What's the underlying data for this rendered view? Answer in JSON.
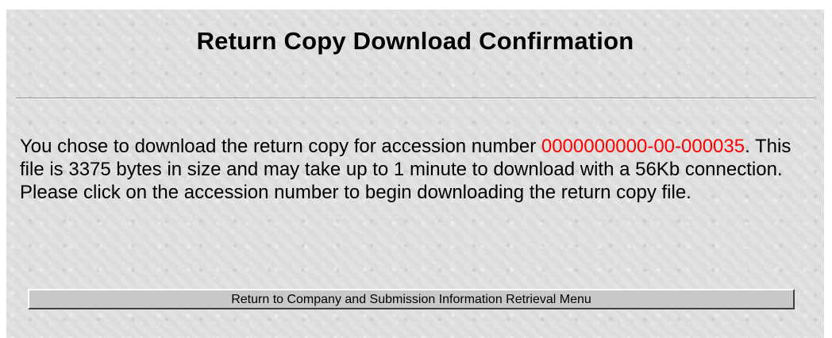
{
  "page": {
    "title": "Return Copy Download Confirmation"
  },
  "message": {
    "prefix": "You chose to download the return copy for accession number ",
    "accession_number": "0000000000-00-000035",
    "suffix": ". This file is 3375 bytes in size and may take up to 1 minute to download with a 56Kb connection. Please click on the accession number to begin downloading the return copy file."
  },
  "buttons": {
    "return_menu_label": "Return to Company and Submission Information Retrieval Menu"
  },
  "colors": {
    "accession_link": "#ff0000",
    "background": "#dcdcdc"
  }
}
